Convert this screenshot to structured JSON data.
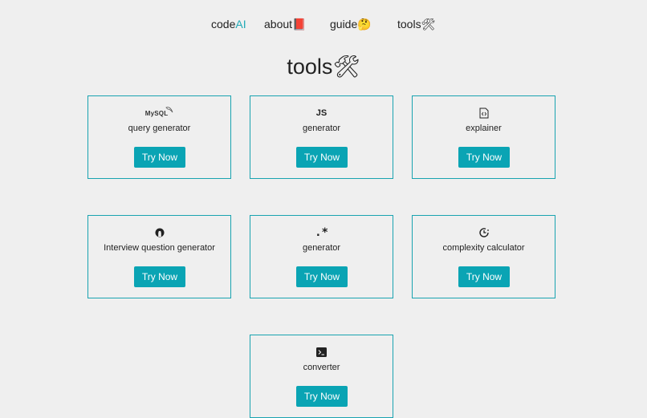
{
  "nav": {
    "brand_prefix": "code",
    "brand_accent": "AI",
    "about_label": "about",
    "about_emoji": "📕",
    "guide_label": "guide",
    "guide_emoji": "🤔",
    "tools_label": "tools",
    "tools_emoji": "🛠"
  },
  "page": {
    "title": "tools",
    "title_emoji": "🛠"
  },
  "cards": [
    {
      "icon": "mysql-logo-icon",
      "icon_text": "MySQL",
      "label": "query generator",
      "button": "Try Now"
    },
    {
      "icon": "js-logo-icon",
      "icon_text": "JS",
      "label": "generator",
      "button": "Try Now"
    },
    {
      "icon": "file-code-icon",
      "icon_text": "",
      "label": "explainer",
      "button": "Try Now"
    },
    {
      "icon": "interview-logo-icon",
      "icon_text": "",
      "label": "Interview question generator",
      "button": "Try Now"
    },
    {
      "icon": "regex-icon",
      "icon_text": ".*",
      "label": "generator",
      "button": "Try Now"
    },
    {
      "icon": "clock-icon",
      "icon_text": "",
      "label": "complexity calculator",
      "button": "Try Now"
    },
    {
      "icon": "terminal-icon",
      "icon_text": "",
      "label": "converter",
      "button": "Try Now"
    }
  ],
  "colors": {
    "accent": "#0aa4b4",
    "background": "#efefef",
    "card_border": "#19a3b0"
  }
}
